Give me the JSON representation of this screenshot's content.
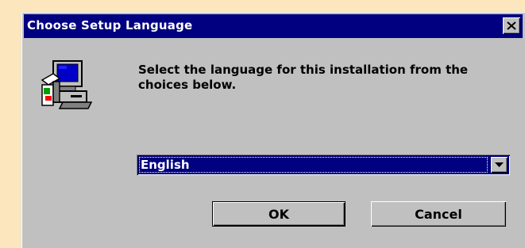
{
  "dialog": {
    "title": "Choose Setup Language",
    "close_icon": "close-icon",
    "app_icon": "computer-setup-icon",
    "message": "Select the language for this installation from the choices below.",
    "language_select": {
      "selected": "English",
      "dropdown_icon": "chevron-down-icon"
    },
    "ok_label": "OK",
    "cancel_label": "Cancel"
  },
  "colors": {
    "titlebar": "#000080",
    "dialog_face": "#c0c0c0",
    "desktop": "#fbe6bd",
    "selection": "#000080"
  }
}
